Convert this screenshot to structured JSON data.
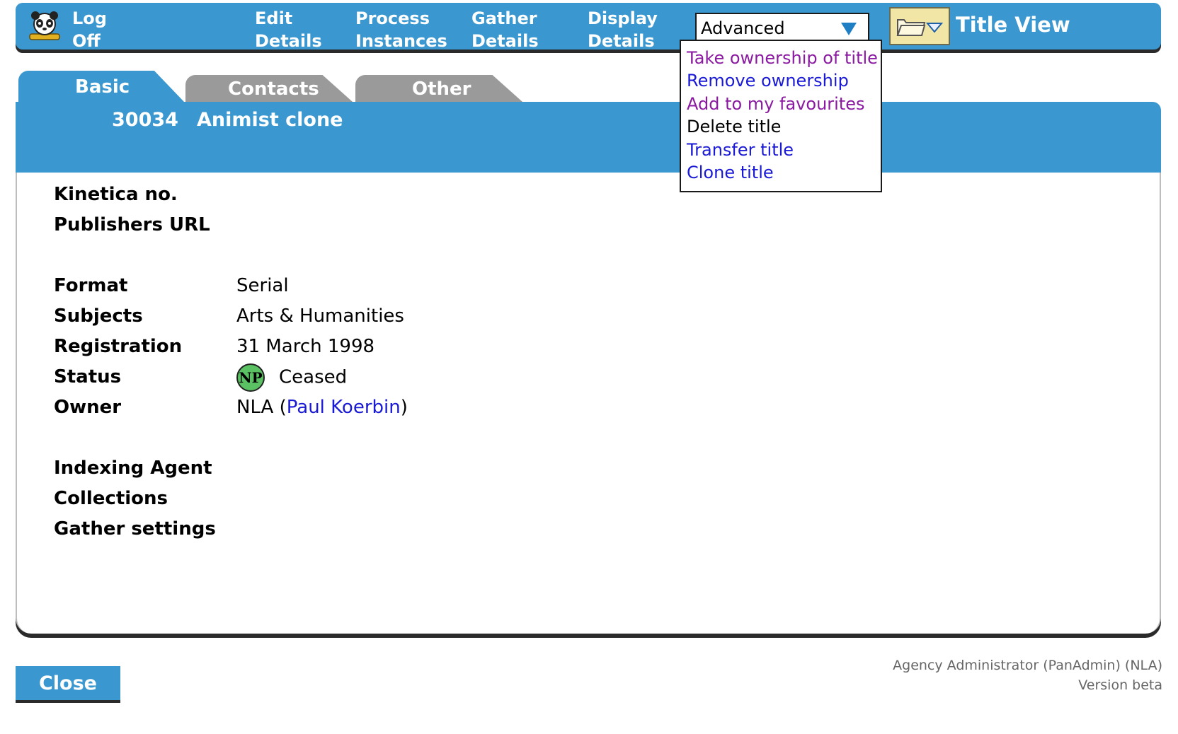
{
  "nav": {
    "log_off": [
      "Log",
      "Off"
    ],
    "edit_details": [
      "Edit",
      "Details"
    ],
    "process_instances": [
      "Process",
      "Instances"
    ],
    "gather_details": [
      "Gather",
      "Details"
    ],
    "display_details": [
      "Display",
      "Details"
    ]
  },
  "advanced_select": {
    "selected": "Advanced"
  },
  "view_title": "Title View",
  "advanced_menu": {
    "items": [
      {
        "label": "Take ownership of title",
        "color": "#8a1aa0"
      },
      {
        "label": "Remove ownership",
        "color": "#1a1ad6"
      },
      {
        "label": "Add to my favourites",
        "color": "#8a1aa0"
      },
      {
        "label": "Delete title",
        "color": "#000000"
      },
      {
        "label": "Transfer title",
        "color": "#1a1ad6"
      },
      {
        "label": "Clone title",
        "color": "#1a1ad6"
      }
    ]
  },
  "tabs": [
    {
      "label": "Basic",
      "active": true
    },
    {
      "label": "Contacts",
      "active": false
    },
    {
      "label": "Other",
      "active": false
    }
  ],
  "title": {
    "id": "30034",
    "name": "Animist clone"
  },
  "fields": {
    "kinetica_no": {
      "label": "Kinetica no.",
      "value": ""
    },
    "publishers_url": {
      "label": "Publishers URL",
      "value": ""
    },
    "format": {
      "label": "Format",
      "value": "Serial"
    },
    "subjects": {
      "label": "Subjects",
      "value": "Arts & Humanities"
    },
    "registration": {
      "label": "Registration",
      "value": "31 March 1998"
    },
    "status": {
      "label": "Status",
      "badge": "NP",
      "value": "Ceased"
    },
    "owner": {
      "label": "Owner",
      "agency": "NLA",
      "open_paren": "(",
      "person": "Paul Koerbin",
      "close_paren": ")"
    },
    "indexing_agent": {
      "label": "Indexing Agent",
      "value": ""
    },
    "collections": {
      "label": "Collections",
      "value": ""
    },
    "gather_settings": {
      "label": "Gather settings",
      "value": ""
    }
  },
  "close_button": "Close",
  "footer": {
    "user": "Agency Administrator (PanAdmin) (NLA)",
    "version": "Version beta"
  },
  "colors": {
    "brand_blue": "#3a97cf",
    "tab_inactive": "#9a9a9a",
    "link_blue": "#1a1ad6",
    "visited_purple": "#8a1aa0",
    "folder_button": "#f2e6a7",
    "status_badge": "#5bc264"
  },
  "icons": {
    "log_off": "panda-icon",
    "folder": "folder-icon",
    "dropdown": "chevron-down-icon"
  }
}
